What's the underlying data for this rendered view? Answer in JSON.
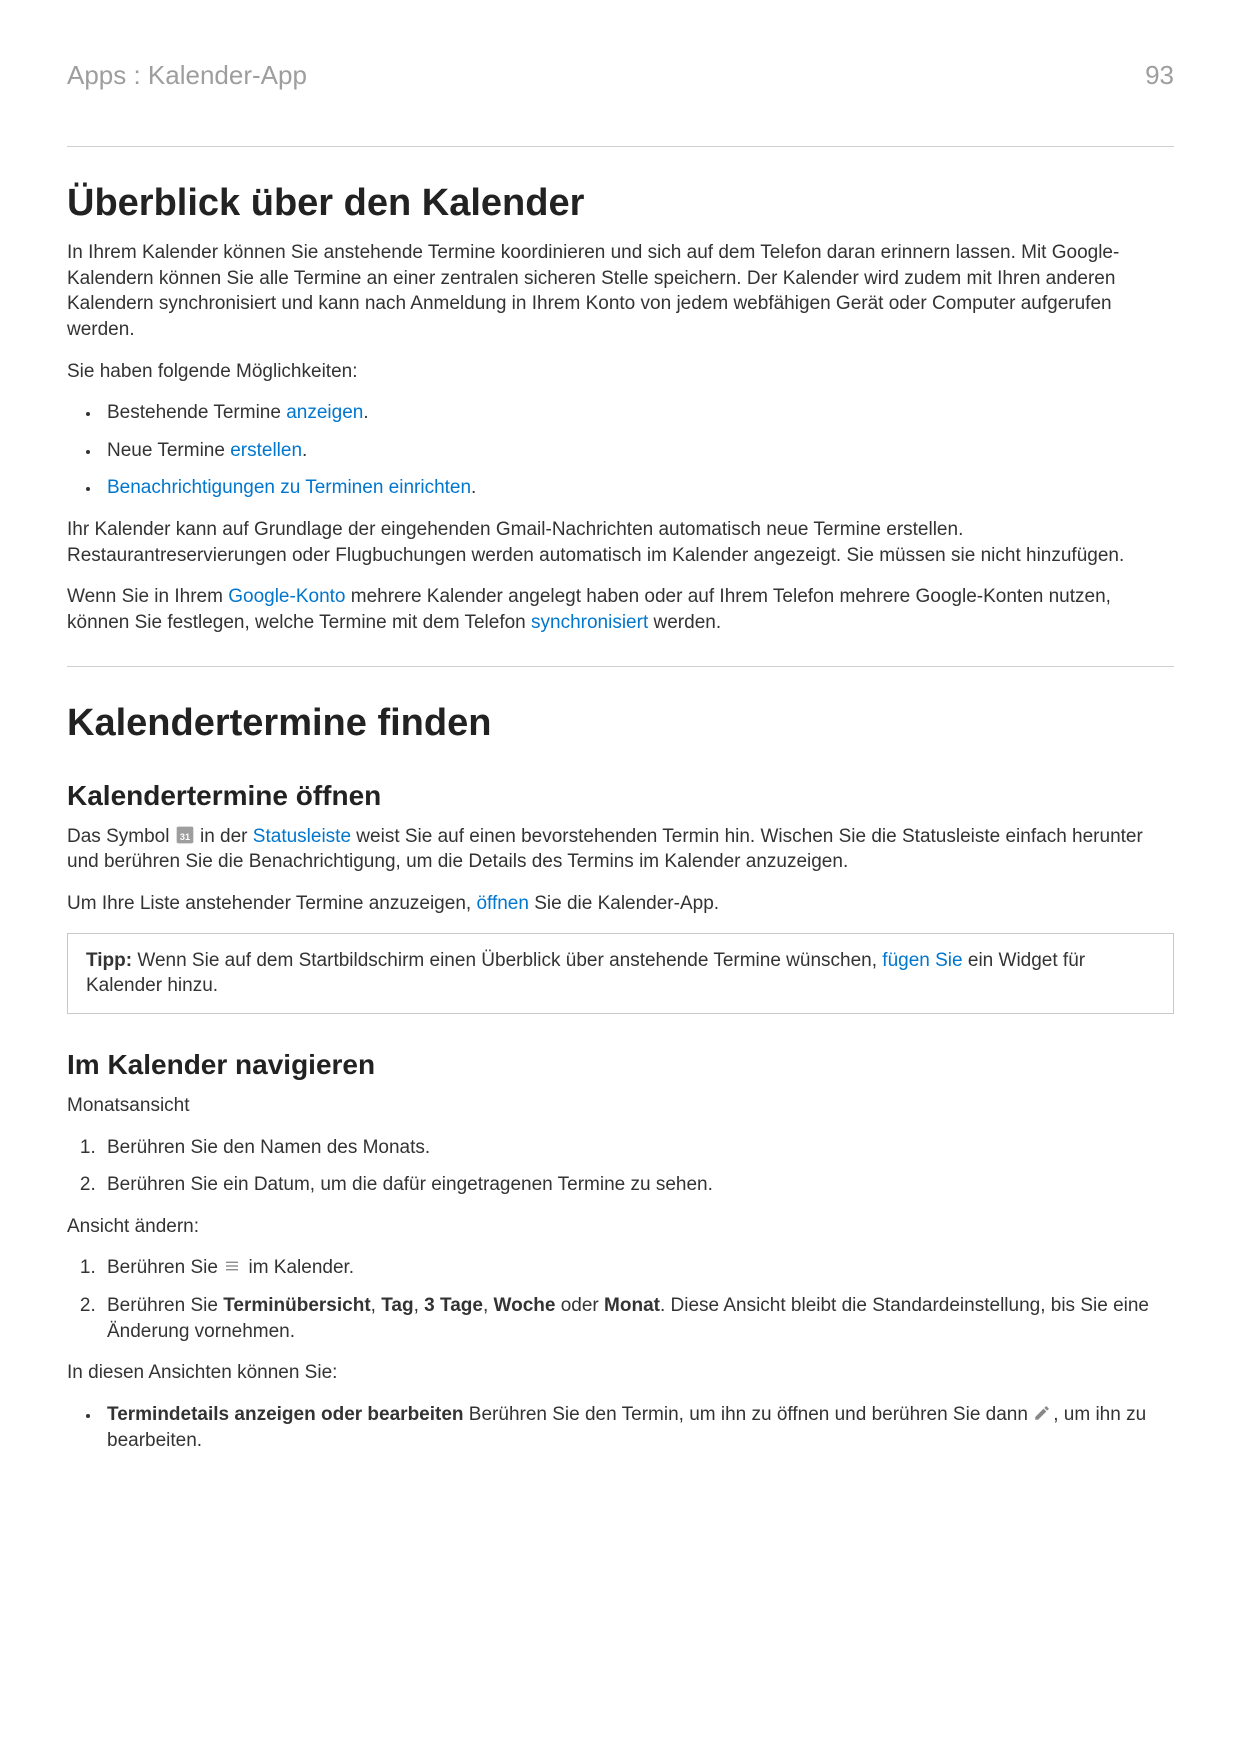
{
  "header": {
    "breadcrumb": "Apps : Kalender-App",
    "page_number": "93"
  },
  "section1": {
    "title": "Überblick über den Kalender",
    "p1": "In Ihrem Kalender können Sie anstehende Termine koordinieren und sich auf dem Telefon daran erinnern lassen. Mit Google-Kalendern können Sie alle Termine an einer zentralen sicheren Stelle speichern. Der Kalender wird zudem mit Ihren anderen Kalendern synchronisiert und kann nach Anmeldung in Ihrem Konto von jedem webfähigen Gerät oder Computer aufgerufen werden.",
    "p2": "Sie haben folgende Möglichkeiten:",
    "li1_a": "Bestehende Termine ",
    "li1_link": "anzeigen",
    "li1_b": ".",
    "li2_a": "Neue Termine ",
    "li2_link": "erstellen",
    "li2_b": ".",
    "li3_link": "Benachrichtigungen zu Terminen einrichten",
    "li3_b": ".",
    "p3": "Ihr Kalender kann auf Grundlage der eingehenden Gmail-Nachrichten automatisch neue Termine erstellen. Restaurantreservierungen oder Flugbuchungen werden automatisch im Kalender angezeigt. Sie müssen sie nicht hinzufügen.",
    "p4_a": "Wenn Sie in Ihrem ",
    "p4_link1": "Google-Konto",
    "p4_b": " mehrere Kalender angelegt haben oder auf Ihrem Telefon mehrere Google-Konten nutzen, können Sie festlegen, welche Termine mit dem Telefon ",
    "p4_link2": "synchronisiert",
    "p4_c": " werden."
  },
  "section2": {
    "title": "Kalendertermine finden",
    "sub1": "Kalendertermine öffnen",
    "s1p1_a": "Das Symbol ",
    "s1p1_b": " in der ",
    "s1p1_link": "Statusleiste",
    "s1p1_c": " weist Sie auf einen bevorstehenden Termin hin. Wischen Sie die Statusleiste einfach herunter und berühren Sie die Benachrichtigung, um die Details des Termins im Kalender anzuzeigen.",
    "s1p2_a": "Um Ihre Liste anstehender Termine anzuzeigen, ",
    "s1p2_link": "öffnen",
    "s1p2_b": " Sie die Kalender-App.",
    "tip_label": "Tipp: ",
    "tip_a": "Wenn Sie auf dem Startbildschirm einen Überblick über anstehende Termine wünschen, ",
    "tip_link": "fügen Sie",
    "tip_b": " ein Widget für Kalender hinzu.",
    "sub2": "Im Kalender navigieren",
    "s2p1": "Monatsansicht",
    "s2ol_li1": "Berühren Sie den Namen des Monats.",
    "s2ol_li2": "Berühren Sie ein Datum, um die dafür eingetragenen Termine zu sehen.",
    "s2p2": "Ansicht ändern:",
    "s2ol2_li1_a": "Berühren Sie ",
    "s2ol2_li1_b": " im Kalender.",
    "s2ol2_li2_a": "Berühren Sie ",
    "s2ol2_li2_b1": "Terminübersicht",
    "s2ol2_li2_b2": "Tag",
    "s2ol2_li2_b3": "3 Tage",
    "s2ol2_li2_b4": "Woche",
    "s2ol2_li2_sep": ", ",
    "s2ol2_li2_or": " oder ",
    "s2ol2_li2_b5": "Monat",
    "s2ol2_li2_c": ". Diese Ansicht bleibt die Standardeinstellung, bis Sie eine Änderung vornehmen.",
    "s2p3": "In diesen Ansichten können Sie:",
    "s2ul_li1_b": "Termindetails anzeigen oder bearbeiten",
    "s2ul_li1_a": " Berühren Sie den Termin, um ihn zu öffnen und berühren Sie dann ",
    "s2ul_li1_c": ", um ihn zu bearbeiten."
  }
}
